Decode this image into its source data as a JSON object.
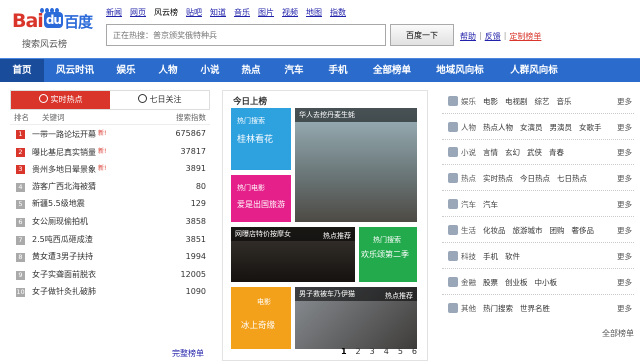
{
  "logo": {
    "text_left": "Bai",
    "text_badge": "du",
    "text_right": "百度",
    "subtitle": "搜索风云榜"
  },
  "top_nav": [
    "新闻",
    "网页",
    "风云榜",
    "贴吧",
    "知道",
    "音乐",
    "图片",
    "视频",
    "地图",
    "指数"
  ],
  "top_nav_active": 2,
  "search": {
    "placeholder": "正在热搜：普京颁奖俄特种兵",
    "button": "百度一下"
  },
  "top_links": {
    "help": "帮助",
    "sep": "|",
    "feedback": "反馈",
    "custom": "定制榜单"
  },
  "main_nav": [
    "首页",
    "风云时讯",
    "娱乐",
    "人物",
    "小说",
    "热点",
    "汽车",
    "手机",
    "全部榜单",
    "地域风向标",
    "人群风向标"
  ],
  "main_nav_active": 0,
  "left_panel": {
    "tabs": [
      "实时热点",
      "七日关注"
    ],
    "headers": {
      "rank": "排名",
      "keyword": "关键词",
      "index": "搜索指数"
    },
    "new_badge": "新!",
    "rows": [
      {
        "rank": "1",
        "keyword": "一带一路论坛开幕",
        "new": true,
        "index": "675867"
      },
      {
        "rank": "2",
        "keyword": "曝比基尼真实销量",
        "new": true,
        "index": "37817"
      },
      {
        "rank": "3",
        "keyword": "贵州多地日晕景象",
        "new": true,
        "index": "3891"
      },
      {
        "rank": "4",
        "keyword": "游客广西北海被猜",
        "new": false,
        "index": "80"
      },
      {
        "rank": "5",
        "keyword": "新疆5.5级地震",
        "new": false,
        "index": "129"
      },
      {
        "rank": "6",
        "keyword": "女公厕现偷拍机",
        "new": false,
        "index": "3858"
      },
      {
        "rank": "7",
        "keyword": "2.5吨西瓜砸成渣",
        "new": false,
        "index": "3851"
      },
      {
        "rank": "8",
        "keyword": "黄女遭3男子扶持",
        "new": false,
        "index": "1994"
      },
      {
        "rank": "9",
        "keyword": "女子实聋面前脱衣",
        "new": false,
        "index": "12005"
      },
      {
        "rank": "10",
        "keyword": "女子做针灸扎破肺",
        "new": false,
        "index": "1090"
      }
    ],
    "more": "完整榜单"
  },
  "center_panel": {
    "title": "今日上榜",
    "tiles": [
      {
        "tag": "热门搜索",
        "title": "桂林看花"
      },
      {
        "caption": "华人去挖丹麦生蚝"
      },
      {
        "tag": "热门电影",
        "title": "爱是出国旅游"
      },
      {
        "caption": "网曝店特价按摩女",
        "tag": "热点推荐"
      },
      {
        "tag": "热门搜索",
        "title": "欢乐颂第二季"
      },
      {
        "tag": "电影",
        "title": "冰上奇缘"
      },
      {
        "caption": "男子救被车乃伊猫",
        "tag": "热点推荐"
      }
    ],
    "pages": [
      "1",
      "2",
      "3",
      "4",
      "5",
      "6"
    ],
    "page_active": 0
  },
  "right_panel": {
    "rows": [
      {
        "cat": "娱乐",
        "items": [
          "电影",
          "电视剧",
          "综艺",
          "音乐"
        ],
        "more": "更多"
      },
      {
        "cat": "人物",
        "items": [
          "热点人物",
          "女演员",
          "男演员",
          "女歌手"
        ],
        "more": "更多"
      },
      {
        "cat": "小说",
        "items": [
          "言情",
          "玄幻",
          "武侠",
          "青春"
        ],
        "more": "更多"
      },
      {
        "cat": "热点",
        "items": [
          "实时热点",
          "今日热点",
          "七日热点"
        ],
        "more": "更多"
      },
      {
        "cat": "汽车",
        "items": [
          "汽车"
        ],
        "more": "更多"
      },
      {
        "cat": "生活",
        "items": [
          "化妆品",
          "旅游城市",
          "团购",
          "奢侈品"
        ],
        "more": "更多"
      },
      {
        "cat": "科技",
        "items": [
          "手机",
          "软件"
        ],
        "more": "更多"
      },
      {
        "cat": "金融",
        "items": [
          "股票",
          "创业板",
          "中小板"
        ],
        "more": "更多"
      },
      {
        "cat": "其他",
        "items": [
          "热门搜索",
          "世界名胜"
        ],
        "more": "更多"
      }
    ],
    "all": "全部榜单"
  },
  "colors": {
    "nav_blue": "#2a6bcc",
    "accent_red": "#d9352b"
  }
}
